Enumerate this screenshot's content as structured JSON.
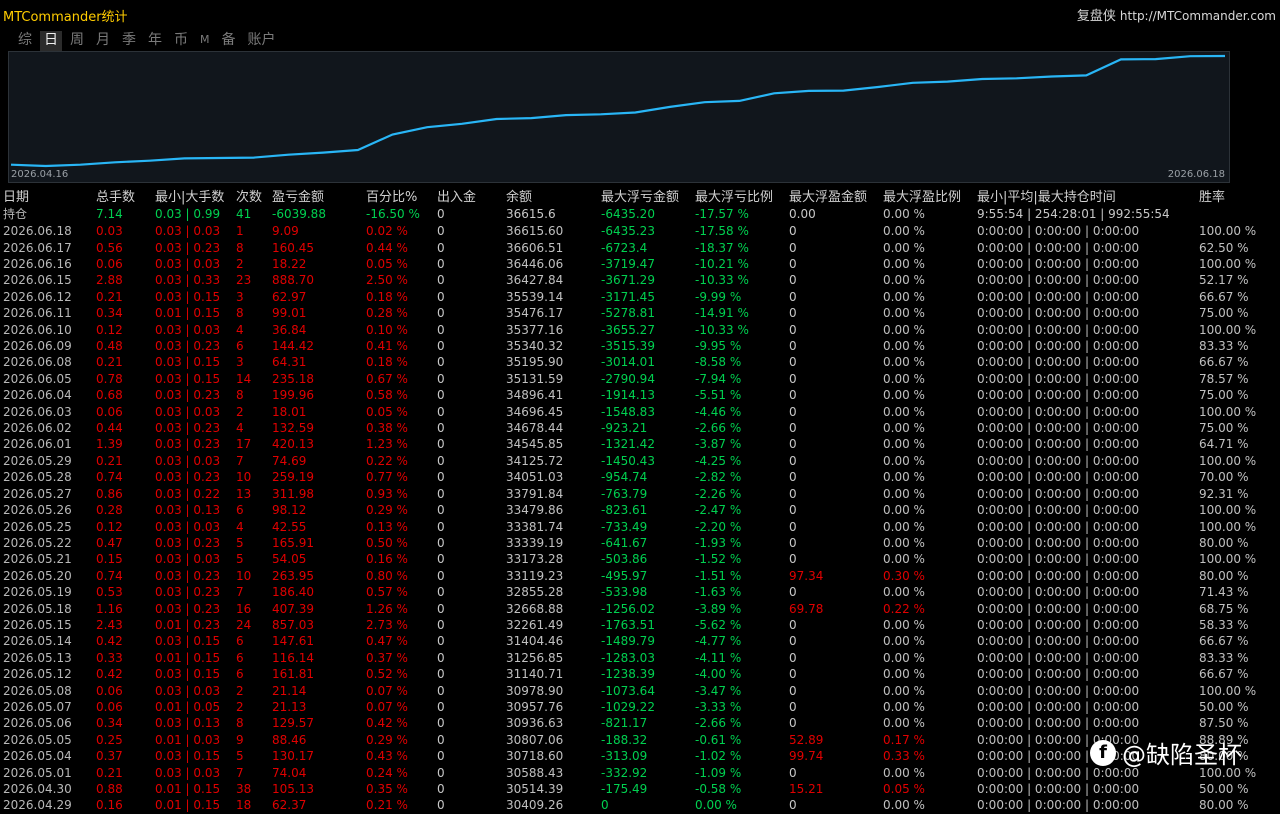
{
  "app": {
    "title": "MTCommander统计",
    "brand": "复盘侠",
    "url": "http://MTCommander.com"
  },
  "tabs": [
    {
      "label": "综",
      "active": false
    },
    {
      "label": "日",
      "active": true
    },
    {
      "label": "周",
      "active": false
    },
    {
      "label": "月",
      "active": false
    },
    {
      "label": "季",
      "active": false
    },
    {
      "label": "年",
      "active": false
    },
    {
      "label": "币",
      "active": false
    },
    {
      "label": "M",
      "active": false
    },
    {
      "label": "备",
      "active": false
    },
    {
      "label": "账户",
      "active": false
    }
  ],
  "chart": {
    "start_label": "2026.04.16",
    "end_label": "2026.06.18",
    "line_color": "#29b6f6",
    "series": [
      30588.43,
      30514.39,
      30588.43,
      30718.6,
      30807.06,
      30936.63,
      30957.76,
      30978.9,
      31140.71,
      31256.85,
      31404.46,
      32261.49,
      32668.88,
      32855.28,
      33119.23,
      33173.28,
      33339.19,
      33381.74,
      33479.86,
      33791.84,
      34051.03,
      34125.72,
      34545.85,
      34678.44,
      34696.45,
      34896.41,
      35131.59,
      35195.9,
      35340.32,
      35377.16,
      35476.17,
      35539.14,
      36427.84,
      36446.06,
      36606.51,
      36615.6
    ]
  },
  "table": {
    "headers": [
      "日期",
      "总手数",
      "最小|大手数",
      "次数",
      "盈亏金额",
      "百分比%",
      "出入金",
      "余额",
      "最大浮亏金额",
      "最大浮亏比例",
      "最大浮盈金额",
      "最大浮盈比例",
      "最小|平均|最大持仓时间",
      "胜率"
    ],
    "holding": {
      "date": "持仓",
      "lots": "7.14",
      "minmax": "0.03 | 0.99",
      "count": "41",
      "pnl": "-6039.88",
      "pct": "-16.50 %",
      "flow": "0",
      "balance": "36615.6",
      "max_loss": "-6435.20",
      "max_loss_pct": "-17.57 %",
      "max_profit": "0.00",
      "max_profit_pct": "0.00 %",
      "hold_time": "9:55:54 | 254:28:01 | 992:55:54",
      "win_rate": ""
    },
    "rows": [
      [
        "2026.06.18",
        "0.03",
        "0.03 | 0.03",
        "1",
        "9.09",
        "0.02 %",
        "0",
        "36615.60",
        "-6435.23",
        "-17.58 %",
        "0",
        "0.00 %",
        "0:00:00 | 0:00:00 | 0:00:00",
        "100.00 %"
      ],
      [
        "2026.06.17",
        "0.56",
        "0.03 | 0.23",
        "8",
        "160.45",
        "0.44 %",
        "0",
        "36606.51",
        "-6723.4",
        "-18.37 %",
        "0",
        "0.00 %",
        "0:00:00 | 0:00:00 | 0:00:00",
        "62.50 %"
      ],
      [
        "2026.06.16",
        "0.06",
        "0.03 | 0.03",
        "2",
        "18.22",
        "0.05 %",
        "0",
        "36446.06",
        "-3719.47",
        "-10.21 %",
        "0",
        "0.00 %",
        "0:00:00 | 0:00:00 | 0:00:00",
        "100.00 %"
      ],
      [
        "2026.06.15",
        "2.88",
        "0.03 | 0.33",
        "23",
        "888.70",
        "2.50 %",
        "0",
        "36427.84",
        "-3671.29",
        "-10.33 %",
        "0",
        "0.00 %",
        "0:00:00 | 0:00:00 | 0:00:00",
        "52.17 %"
      ],
      [
        "2026.06.12",
        "0.21",
        "0.03 | 0.15",
        "3",
        "62.97",
        "0.18 %",
        "0",
        "35539.14",
        "-3171.45",
        "-9.99 %",
        "0",
        "0.00 %",
        "0:00:00 | 0:00:00 | 0:00:00",
        "66.67 %"
      ],
      [
        "2026.06.11",
        "0.34",
        "0.01 | 0.15",
        "8",
        "99.01",
        "0.28 %",
        "0",
        "35476.17",
        "-5278.81",
        "-14.91 %",
        "0",
        "0.00 %",
        "0:00:00 | 0:00:00 | 0:00:00",
        "75.00 %"
      ],
      [
        "2026.06.10",
        "0.12",
        "0.03 | 0.03",
        "4",
        "36.84",
        "0.10 %",
        "0",
        "35377.16",
        "-3655.27",
        "-10.33 %",
        "0",
        "0.00 %",
        "0:00:00 | 0:00:00 | 0:00:00",
        "100.00 %"
      ],
      [
        "2026.06.09",
        "0.48",
        "0.03 | 0.23",
        "6",
        "144.42",
        "0.41 %",
        "0",
        "35340.32",
        "-3515.39",
        "-9.95 %",
        "0",
        "0.00 %",
        "0:00:00 | 0:00:00 | 0:00:00",
        "83.33 %"
      ],
      [
        "2026.06.08",
        "0.21",
        "0.03 | 0.15",
        "3",
        "64.31",
        "0.18 %",
        "0",
        "35195.90",
        "-3014.01",
        "-8.58 %",
        "0",
        "0.00 %",
        "0:00:00 | 0:00:00 | 0:00:00",
        "66.67 %"
      ],
      [
        "2026.06.05",
        "0.78",
        "0.03 | 0.15",
        "14",
        "235.18",
        "0.67 %",
        "0",
        "35131.59",
        "-2790.94",
        "-7.94 %",
        "0",
        "0.00 %",
        "0:00:00 | 0:00:00 | 0:00:00",
        "78.57 %"
      ],
      [
        "2026.06.04",
        "0.68",
        "0.03 | 0.23",
        "8",
        "199.96",
        "0.58 %",
        "0",
        "34896.41",
        "-1914.13",
        "-5.51 %",
        "0",
        "0.00 %",
        "0:00:00 | 0:00:00 | 0:00:00",
        "75.00 %"
      ],
      [
        "2026.06.03",
        "0.06",
        "0.03 | 0.03",
        "2",
        "18.01",
        "0.05 %",
        "0",
        "34696.45",
        "-1548.83",
        "-4.46 %",
        "0",
        "0.00 %",
        "0:00:00 | 0:00:00 | 0:00:00",
        "100.00 %"
      ],
      [
        "2026.06.02",
        "0.44",
        "0.03 | 0.23",
        "4",
        "132.59",
        "0.38 %",
        "0",
        "34678.44",
        "-923.21",
        "-2.66 %",
        "0",
        "0.00 %",
        "0:00:00 | 0:00:00 | 0:00:00",
        "75.00 %"
      ],
      [
        "2026.06.01",
        "1.39",
        "0.03 | 0.23",
        "17",
        "420.13",
        "1.23 %",
        "0",
        "34545.85",
        "-1321.42",
        "-3.87 %",
        "0",
        "0.00 %",
        "0:00:00 | 0:00:00 | 0:00:00",
        "64.71 %"
      ],
      [
        "2026.05.29",
        "0.21",
        "0.03 | 0.03",
        "7",
        "74.69",
        "0.22 %",
        "0",
        "34125.72",
        "-1450.43",
        "-4.25 %",
        "0",
        "0.00 %",
        "0:00:00 | 0:00:00 | 0:00:00",
        "100.00 %"
      ],
      [
        "2026.05.28",
        "0.74",
        "0.03 | 0.23",
        "10",
        "259.19",
        "0.77 %",
        "0",
        "34051.03",
        "-954.74",
        "-2.82 %",
        "0",
        "0.00 %",
        "0:00:00 | 0:00:00 | 0:00:00",
        "70.00 %"
      ],
      [
        "2026.05.27",
        "0.86",
        "0.03 | 0.22",
        "13",
        "311.98",
        "0.93 %",
        "0",
        "33791.84",
        "-763.79",
        "-2.26 %",
        "0",
        "0.00 %",
        "0:00:00 | 0:00:00 | 0:00:00",
        "92.31 %"
      ],
      [
        "2026.05.26",
        "0.28",
        "0.03 | 0.13",
        "6",
        "98.12",
        "0.29 %",
        "0",
        "33479.86",
        "-823.61",
        "-2.47 %",
        "0",
        "0.00 %",
        "0:00:00 | 0:00:00 | 0:00:00",
        "100.00 %"
      ],
      [
        "2026.05.25",
        "0.12",
        "0.03 | 0.03",
        "4",
        "42.55",
        "0.13 %",
        "0",
        "33381.74",
        "-733.49",
        "-2.20 %",
        "0",
        "0.00 %",
        "0:00:00 | 0:00:00 | 0:00:00",
        "100.00 %"
      ],
      [
        "2026.05.22",
        "0.47",
        "0.03 | 0.23",
        "5",
        "165.91",
        "0.50 %",
        "0",
        "33339.19",
        "-641.67",
        "-1.93 %",
        "0",
        "0.00 %",
        "0:00:00 | 0:00:00 | 0:00:00",
        "80.00 %"
      ],
      [
        "2026.05.21",
        "0.15",
        "0.03 | 0.03",
        "5",
        "54.05",
        "0.16 %",
        "0",
        "33173.28",
        "-503.86",
        "-1.52 %",
        "0",
        "0.00 %",
        "0:00:00 | 0:00:00 | 0:00:00",
        "100.00 %"
      ],
      [
        "2026.05.20",
        "0.74",
        "0.03 | 0.23",
        "10",
        "263.95",
        "0.80 %",
        "0",
        "33119.23",
        "-495.97",
        "-1.51 %",
        "97.34",
        "0.30 %",
        "0:00:00 | 0:00:00 | 0:00:00",
        "80.00 %"
      ],
      [
        "2026.05.19",
        "0.53",
        "0.03 | 0.23",
        "7",
        "186.40",
        "0.57 %",
        "0",
        "32855.28",
        "-533.98",
        "-1.63 %",
        "0",
        "0.00 %",
        "0:00:00 | 0:00:00 | 0:00:00",
        "71.43 %"
      ],
      [
        "2026.05.18",
        "1.16",
        "0.03 | 0.23",
        "16",
        "407.39",
        "1.26 %",
        "0",
        "32668.88",
        "-1256.02",
        "-3.89 %",
        "69.78",
        "0.22 %",
        "0:00:00 | 0:00:00 | 0:00:00",
        "68.75 %"
      ],
      [
        "2026.05.15",
        "2.43",
        "0.01 | 0.23",
        "24",
        "857.03",
        "2.73 %",
        "0",
        "32261.49",
        "-1763.51",
        "-5.62 %",
        "0",
        "0.00 %",
        "0:00:00 | 0:00:00 | 0:00:00",
        "58.33 %"
      ],
      [
        "2026.05.14",
        "0.42",
        "0.03 | 0.15",
        "6",
        "147.61",
        "0.47 %",
        "0",
        "31404.46",
        "-1489.79",
        "-4.77 %",
        "0",
        "0.00 %",
        "0:00:00 | 0:00:00 | 0:00:00",
        "66.67 %"
      ],
      [
        "2026.05.13",
        "0.33",
        "0.01 | 0.15",
        "6",
        "116.14",
        "0.37 %",
        "0",
        "31256.85",
        "-1283.03",
        "-4.11 %",
        "0",
        "0.00 %",
        "0:00:00 | 0:00:00 | 0:00:00",
        "83.33 %"
      ],
      [
        "2026.05.12",
        "0.42",
        "0.03 | 0.15",
        "6",
        "161.81",
        "0.52 %",
        "0",
        "31140.71",
        "-1238.39",
        "-4.00 %",
        "0",
        "0.00 %",
        "0:00:00 | 0:00:00 | 0:00:00",
        "66.67 %"
      ],
      [
        "2026.05.08",
        "0.06",
        "0.03 | 0.03",
        "2",
        "21.14",
        "0.07 %",
        "0",
        "30978.90",
        "-1073.64",
        "-3.47 %",
        "0",
        "0.00 %",
        "0:00:00 | 0:00:00 | 0:00:00",
        "100.00 %"
      ],
      [
        "2026.05.07",
        "0.06",
        "0.01 | 0.05",
        "2",
        "21.13",
        "0.07 %",
        "0",
        "30957.76",
        "-1029.22",
        "-3.33 %",
        "0",
        "0.00 %",
        "0:00:00 | 0:00:00 | 0:00:00",
        "50.00 %"
      ],
      [
        "2026.05.06",
        "0.34",
        "0.03 | 0.13",
        "8",
        "129.57",
        "0.42 %",
        "0",
        "30936.63",
        "-821.17",
        "-2.66 %",
        "0",
        "0.00 %",
        "0:00:00 | 0:00:00 | 0:00:00",
        "87.50 %"
      ],
      [
        "2026.05.05",
        "0.25",
        "0.01 | 0.03",
        "9",
        "88.46",
        "0.29 %",
        "0",
        "30807.06",
        "-188.32",
        "-0.61 %",
        "52.89",
        "0.17 %",
        "0:00:00 | 0:00:00 | 0:00:00",
        "88.89 %"
      ],
      [
        "2026.05.04",
        "0.37",
        "0.03 | 0.15",
        "5",
        "130.17",
        "0.43 %",
        "0",
        "30718.60",
        "-313.09",
        "-1.02 %",
        "99.74",
        "0.33 %",
        "0:00:00 | 0:00:00 | 0:00:00",
        "80.00 %"
      ],
      [
        "2026.05.01",
        "0.21",
        "0.03 | 0.03",
        "7",
        "74.04",
        "0.24 %",
        "0",
        "30588.43",
        "-332.92",
        "-1.09 %",
        "0",
        "0.00 %",
        "0:00:00 | 0:00:00 | 0:00:00",
        "100.00 %"
      ],
      [
        "2026.04.30",
        "0.88",
        "0.01 | 0.15",
        "38",
        "105.13",
        "0.35 %",
        "0",
        "30514.39",
        "-175.49",
        "-0.58 %",
        "15.21",
        "0.05 %",
        "0:00:00 | 0:00:00 | 0:00:00",
        "50.00 %"
      ],
      [
        "2026.04.29",
        "0.16",
        "0.01 | 0.15",
        "18",
        "62.37",
        "0.21 %",
        "0",
        "30409.26",
        "0",
        "0.00 %",
        "0",
        "0.00 %",
        "0:00:00 | 0:00:00 | 0:00:00",
        "80.00 %"
      ]
    ]
  },
  "watermark": {
    "logo": "f",
    "text": "@缺陷圣杯"
  }
}
